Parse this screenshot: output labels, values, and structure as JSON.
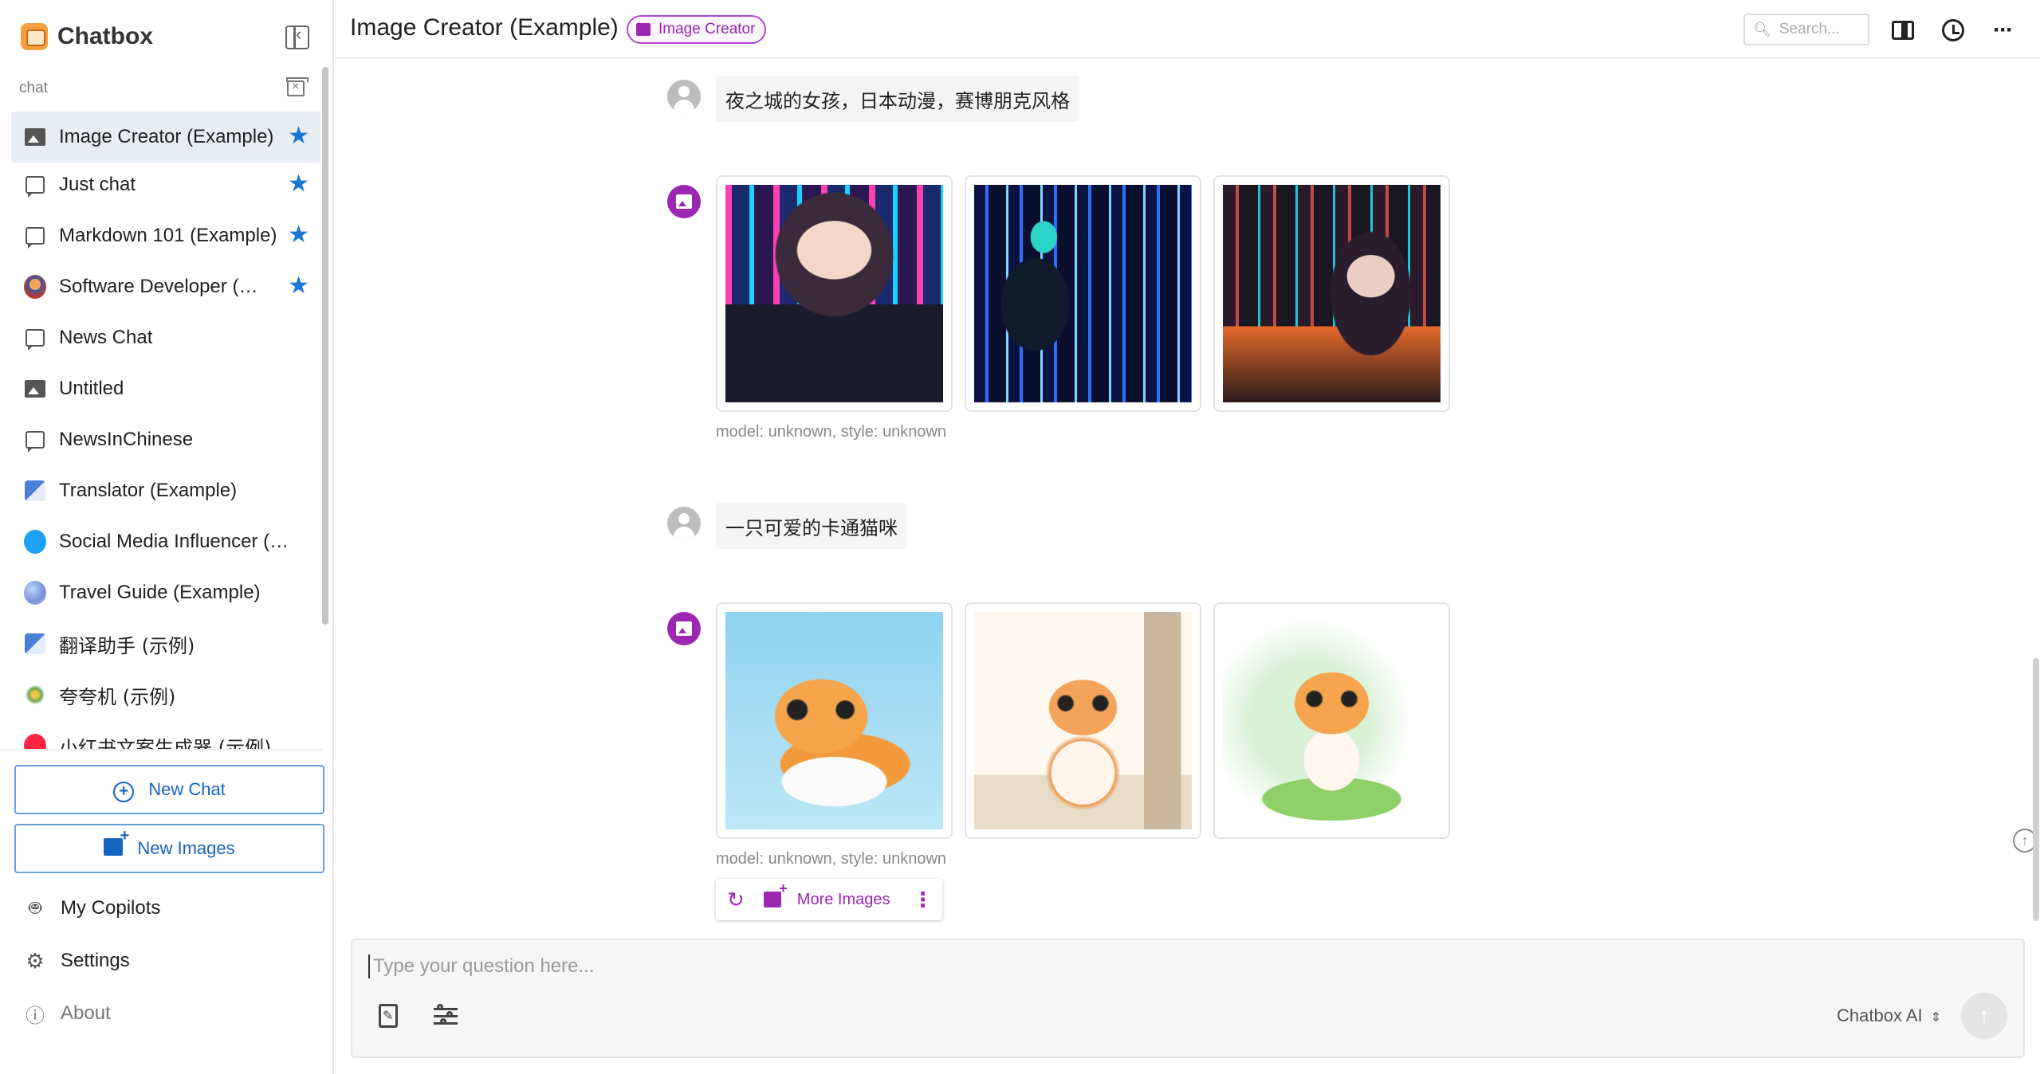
{
  "app": {
    "name": "Chatbox"
  },
  "sidebar": {
    "section_label": "chat",
    "items": [
      {
        "label": "Image Creator (Example)",
        "icon": "image-icon",
        "starred": true,
        "active": true
      },
      {
        "label": "Just chat",
        "icon": "chat-bubble-icon",
        "starred": true,
        "active": false
      },
      {
        "label": "Markdown 101 (Example)",
        "icon": "chat-bubble-icon",
        "starred": true,
        "active": false
      },
      {
        "label": "Software Developer (Example)",
        "icon": "developer-avatar-icon",
        "starred": true,
        "active": false
      },
      {
        "label": "News Chat",
        "icon": "chat-bubble-icon",
        "starred": false,
        "active": false
      },
      {
        "label": "Untitled",
        "icon": "image-icon",
        "starred": false,
        "active": false
      },
      {
        "label": "NewsInChinese",
        "icon": "chat-bubble-icon",
        "starred": false,
        "active": false
      },
      {
        "label": "Translator (Example)",
        "icon": "translator-avatar-icon",
        "starred": false,
        "active": false
      },
      {
        "label": "Social Media Influencer (Example)",
        "icon": "twitter-avatar-icon",
        "starred": false,
        "active": false
      },
      {
        "label": "Travel Guide (Example)",
        "icon": "globe-avatar-icon",
        "starred": false,
        "active": false
      },
      {
        "label": "翻译助手 (示例)",
        "icon": "translator-avatar-icon",
        "starred": false,
        "active": false
      },
      {
        "label": "夸夸机 (示例)",
        "icon": "praise-avatar-icon",
        "starred": false,
        "active": false
      },
      {
        "label": "小红书文案生成器 (示例)",
        "icon": "xiaohongshu-avatar-icon",
        "starred": false,
        "active": false
      }
    ],
    "new_chat_label": "New Chat",
    "new_images_label": "New Images",
    "my_copilots_label": "My Copilots",
    "settings_label": "Settings",
    "about_label": "About"
  },
  "header": {
    "title": "Image Creator (Example)",
    "badge": "Image Creator",
    "search_placeholder": "Search..."
  },
  "messages": [
    {
      "role": "user",
      "text": "夜之城的女孩，日本动漫，赛博朋克风格"
    },
    {
      "role": "assistant",
      "images": [
        "cyberpunk-anime-girl-1",
        "cyberpunk-anime-girl-2",
        "cyberpunk-anime-girl-3"
      ],
      "meta": "model: unknown, style: unknown"
    },
    {
      "role": "user",
      "text": "一只可爱的卡通猫咪"
    },
    {
      "role": "assistant",
      "images": [
        "cartoon-cat-1",
        "cartoon-cat-2",
        "cartoon-cat-3"
      ],
      "meta": "model: unknown, style: unknown"
    }
  ],
  "actions": {
    "more_images_label": "More Images"
  },
  "composer": {
    "placeholder": "Type your question here...",
    "model_label": "Chatbox AI"
  },
  "colors": {
    "accent_blue": "#1976d2",
    "accent_purple": "#9c27b0",
    "active_bg": "#e8edf4"
  }
}
